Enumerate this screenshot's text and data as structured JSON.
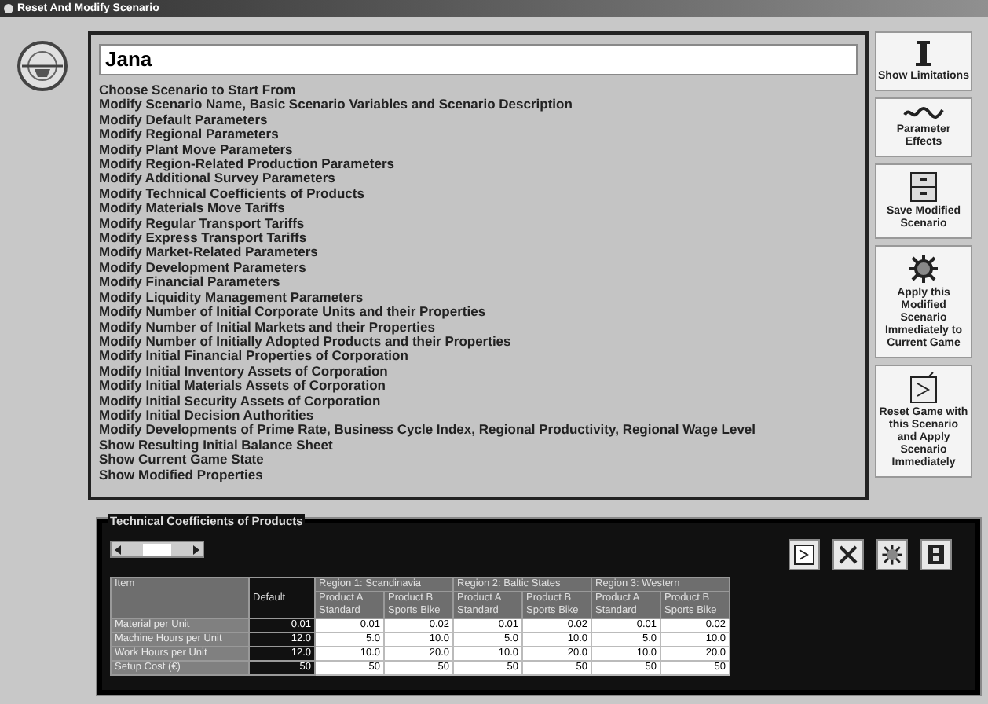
{
  "window": {
    "title": "Reset And Modify Scenario"
  },
  "scenario_name": {
    "value": "Jana"
  },
  "menu_items": [
    "Choose Scenario to Start From",
    "Modify Scenario Name, Basic Scenario Variables and Scenario Description",
    "Modify Default Parameters",
    "Modify Regional Parameters",
    "Modify Plant Move Parameters",
    "Modify Region-Related Production Parameters",
    "Modify Additional Survey Parameters",
    "Modify Technical Coefficients of Products",
    "Modify Materials Move Tariffs",
    "Modify Regular Transport Tariffs",
    "Modify Express Transport Tariffs",
    "Modify Market-Related Parameters",
    "Modify Development Parameters",
    "Modify Financial Parameters",
    "Modify Liquidity Management Parameters",
    "Modify Number of Initial Corporate Units and their Properties",
    "Modify Number of Initial Markets and their Properties",
    "Modify Number of Initially Adopted Products and their Properties",
    "Modify Initial Financial Properties of Corporation",
    "Modify Initial Inventory Assets of Corporation",
    "Modify Initial Materials Assets of Corporation",
    "Modify Initial Security Assets of Corporation",
    "Modify Initial Decision Authorities",
    "Modify Developments of Prime Rate, Business Cycle Index, Regional Productivity, Regional Wage Level",
    "Show Resulting Initial Balance Sheet",
    "Show Current Game State",
    "Show Modified Properties"
  ],
  "side_buttons": [
    {
      "kind": "limits",
      "label": "Show Limitations"
    },
    {
      "kind": "effects",
      "label": "Parameter Effects"
    },
    {
      "kind": "save",
      "label": "Save Modified Scenario"
    },
    {
      "kind": "apply",
      "label": "Apply this Modified Scenario Immediately to Current Game"
    },
    {
      "kind": "reset",
      "label": "Reset Game with this Scenario and Apply Scenario Immediately"
    }
  ],
  "panel": {
    "title": "Technical Coefficients of Products",
    "toolbar": [
      {
        "kind": "reset"
      },
      {
        "kind": "tools"
      },
      {
        "kind": "apply"
      },
      {
        "kind": "film"
      }
    ],
    "table": {
      "item_header": "Item",
      "default_header": "Default",
      "regions": [
        {
          "name": "Region 1: Scandinavia",
          "products": [
            "Product A Standard",
            "Product B Sports Bike"
          ]
        },
        {
          "name": "Region 2: Baltic States",
          "products": [
            "Product A Standard",
            "Product B Sports Bike"
          ]
        },
        {
          "name": "Region 3: Western",
          "products": [
            "Product A Standard",
            "Product B Sports Bike"
          ]
        }
      ],
      "rows": [
        {
          "item": "Material per Unit",
          "default": "0.01",
          "values": [
            "0.01",
            "0.02",
            "0.01",
            "0.02",
            "0.01",
            "0.02"
          ]
        },
        {
          "item": "Machine Hours per Unit",
          "default": "12.0",
          "values": [
            "5.0",
            "10.0",
            "5.0",
            "10.0",
            "5.0",
            "10.0"
          ]
        },
        {
          "item": "Work Hours per Unit",
          "default": "12.0",
          "values": [
            "10.0",
            "20.0",
            "10.0",
            "20.0",
            "10.0",
            "20.0"
          ]
        },
        {
          "item": "Setup Cost (€)",
          "default": "50",
          "values": [
            "50",
            "50",
            "50",
            "50",
            "50",
            "50"
          ]
        }
      ]
    }
  }
}
